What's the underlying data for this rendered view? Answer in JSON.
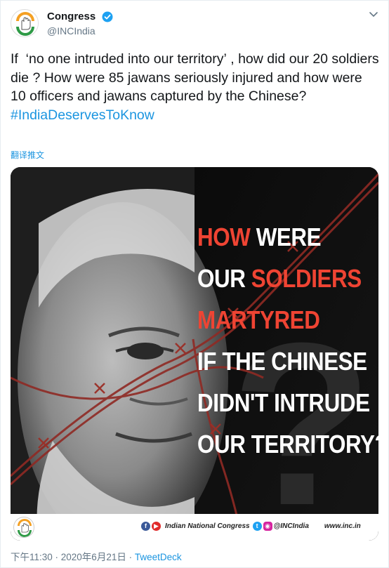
{
  "account": {
    "display_name": "Congress",
    "handle": "@INCIndia",
    "verified": true
  },
  "tweet": {
    "text": "If  ‘no one intruded into our territory’ , how did our 20 soldiers die ? How were 85 jawans seriously injured and how were 10 officers and jawans captured by the Chinese?",
    "hashtag": "#IndiaDeservesToKnow",
    "translate_label": "翻译推文"
  },
  "media": {
    "headline_lines": [
      {
        "parts": [
          {
            "text": "HOW",
            "red": true
          },
          {
            "text": " WERE",
            "red": false
          }
        ]
      },
      {
        "parts": [
          {
            "text": "OUR ",
            "red": false
          },
          {
            "text": "SOLDIERS",
            "red": true
          }
        ]
      },
      {
        "parts": [
          {
            "text": "MARTYRED",
            "red": true
          }
        ]
      },
      {
        "parts": [
          {
            "text": "IF THE CHINESE",
            "red": false
          }
        ]
      },
      {
        "parts": [
          {
            "text": "DIDN'T INTRUDE",
            "red": false
          }
        ]
      },
      {
        "parts": [
          {
            "text": "OUR TERRITORY?",
            "red": false
          }
        ]
      }
    ],
    "footer": {
      "org_name": "Indian National Congress",
      "social_handle": "@INCIndia",
      "website": "www.inc.in"
    }
  },
  "meta": {
    "time_date": "下午11:30 · 2020年6月21日 · ",
    "source": "TweetDeck"
  },
  "colors": {
    "accent": "#1b95e0",
    "headline_red": "#ef4433",
    "muted": "#657786"
  }
}
